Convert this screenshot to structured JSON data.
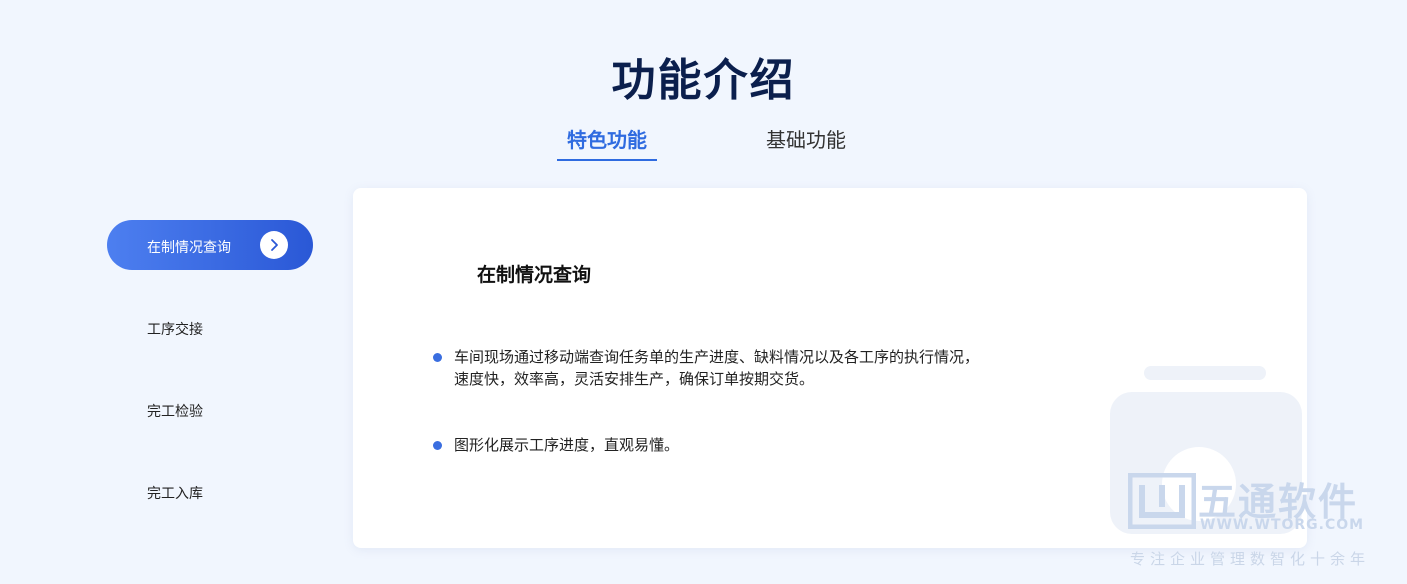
{
  "page_title": "功能介绍",
  "tabs": [
    {
      "label": "特色功能",
      "active": true
    },
    {
      "label": "基础功能",
      "active": false
    }
  ],
  "side_menu": [
    {
      "label": "在制情况查询",
      "active": true
    },
    {
      "label": "工序交接",
      "active": false
    },
    {
      "label": "完工检验",
      "active": false
    },
    {
      "label": "完工入库",
      "active": false
    }
  ],
  "content": {
    "title": "在制情况查询",
    "bullets": [
      "车间现场通过移动端查询任务单的生产进度、缺料情况以及各工序的执行情况， 速度快，效率高，灵活安排生产，确保订单按期交货。",
      "图形化展示工序进度，直观易懂。"
    ]
  },
  "watermark": {
    "brand": "五通软件",
    "url": "WWW.WTORG.COM",
    "slogan": "专注企业管理数智化十余年"
  },
  "colors": {
    "accent": "#2f6be0",
    "title": "#0b1f4d",
    "background": "#f1f6fe"
  }
}
